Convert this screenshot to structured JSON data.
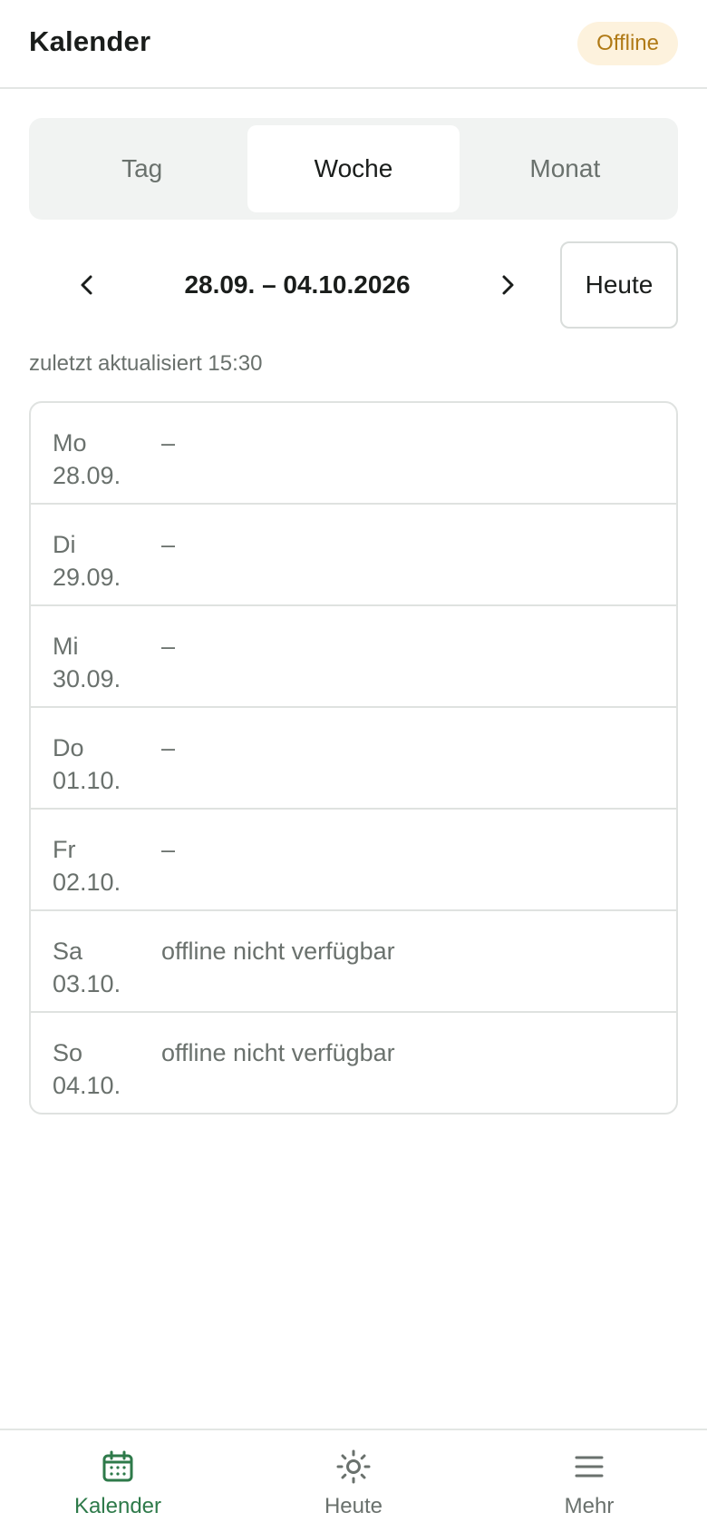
{
  "header": {
    "title": "Kalender",
    "status_badge": "Offline"
  },
  "view_switcher": {
    "tabs": [
      {
        "label": "Tag",
        "active": false
      },
      {
        "label": "Woche",
        "active": true
      },
      {
        "label": "Monat",
        "active": false
      }
    ]
  },
  "week_nav": {
    "prev_icon": "chevron-left-icon",
    "range_label": "28.09. – 04.10.2026",
    "next_icon": "chevron-right-icon",
    "today_label": "Heute"
  },
  "last_updated": "zuletzt aktualisiert 15:30",
  "days": [
    {
      "weekday": "Mo",
      "date": "28.09.",
      "content": "–"
    },
    {
      "weekday": "Di",
      "date": "29.09.",
      "content": "–"
    },
    {
      "weekday": "Mi",
      "date": "30.09.",
      "content": "–"
    },
    {
      "weekday": "Do",
      "date": "01.10.",
      "content": "–"
    },
    {
      "weekday": "Fr",
      "date": "02.10.",
      "content": "–"
    },
    {
      "weekday": "Sa",
      "date": "03.10.",
      "content": "offline nicht verfügbar"
    },
    {
      "weekday": "So",
      "date": "04.10.",
      "content": "offline nicht verfügbar"
    }
  ],
  "tabbar": {
    "items": [
      {
        "label": "Kalender",
        "icon": "calendar-icon",
        "active": true
      },
      {
        "label": "Heute",
        "icon": "sun-icon",
        "active": false
      },
      {
        "label": "Mehr",
        "icon": "menu-icon",
        "active": false
      }
    ]
  },
  "colors": {
    "accent": "#2e7a4a",
    "offline_badge_bg": "#fdf2dd",
    "offline_badge_text": "#b07a16",
    "muted_text": "#6a716d"
  }
}
